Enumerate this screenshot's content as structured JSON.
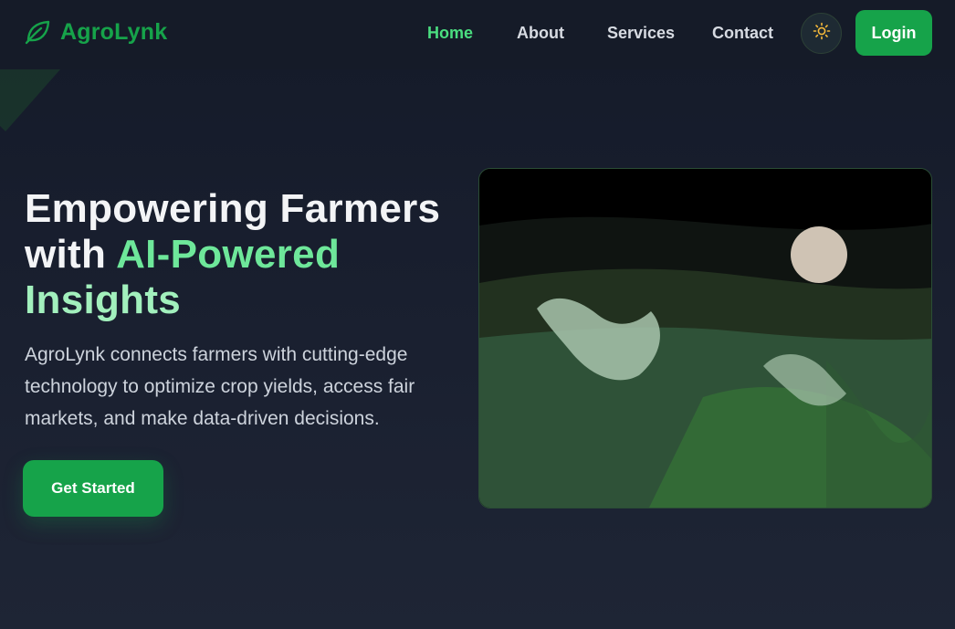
{
  "brand": {
    "name": "AgroLynk",
    "logo_icon": "leaf-icon",
    "color": "#16a34a"
  },
  "nav": {
    "links": [
      {
        "label": "Home",
        "active": true
      },
      {
        "label": "About",
        "active": false
      },
      {
        "label": "Services",
        "active": false
      },
      {
        "label": "Contact",
        "active": false
      }
    ],
    "theme_toggle_icon": "sun-icon",
    "login_label": "Login"
  },
  "hero": {
    "title_line1": "Empowering Farmers",
    "title_with": "with ",
    "title_highlight_1": "AI-Powered",
    "title_highlight_2": "Insights",
    "description": "AgroLynk connects farmers with cutting-edge technology to optimize crop yields, access fair markets, and make data-driven decisions.",
    "cta_label": "Get Started",
    "illustration": "farm-landscape-illustration"
  },
  "colors": {
    "accent": "#16a34a",
    "accent_light": "#86efac",
    "active_link": "#4ade80",
    "background": "#1a2030"
  }
}
